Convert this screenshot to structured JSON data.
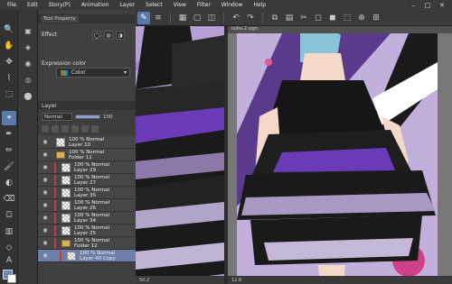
{
  "menu": [
    "File",
    "Edit",
    "Story(P)",
    "Animation",
    "Layer",
    "Select",
    "View",
    "Filter",
    "Window",
    "Help"
  ],
  "window_controls": {
    "minimize": "–",
    "maximize": "□",
    "close": "✕"
  },
  "panel": {
    "tabs": [
      "Tool Property"
    ],
    "effect_label": "Effect",
    "expression_color_label": "Expression color",
    "expression_color_value": "Color",
    "layer_tab": "Layer",
    "blend_mode": "Normal",
    "opacity": "100",
    "opacity_fraction": 1.0
  },
  "layers": [
    {
      "text": "100 % Normal\nLayer 10",
      "type": "layer",
      "indent": 0,
      "selected": false
    },
    {
      "text": "100 % Normal\nFolder 11",
      "type": "folder",
      "indent": 0,
      "selected": false
    },
    {
      "text": "100 % Normal\nLayer 29",
      "type": "layer",
      "indent": 1,
      "selected": false
    },
    {
      "text": "100 % Normal\nLayer 27",
      "type": "layer",
      "indent": 1,
      "selected": false
    },
    {
      "text": "100 % Normal\nLayer 35",
      "type": "layer",
      "indent": 1,
      "selected": false
    },
    {
      "text": "100 % Normal\nLayer 26",
      "type": "layer",
      "indent": 1,
      "selected": false
    },
    {
      "text": "100 % Normal\nLayer 34",
      "type": "layer",
      "indent": 1,
      "selected": false
    },
    {
      "text": "100 % Normal\nLayer 25",
      "type": "layer",
      "indent": 1,
      "selected": false
    },
    {
      "text": "100 % Normal\nFolder 12",
      "type": "folder",
      "indent": 1,
      "selected": false
    },
    {
      "text": "100 % Normal\nLayer 40 Copy",
      "type": "layer",
      "indent": 2,
      "selected": true
    }
  ],
  "canvas": {
    "left_zoom": "50.2",
    "right_zoom": "12.6",
    "right_tab": "lolita 2 sign"
  },
  "colors": {
    "accent": "#5a78a8",
    "main_color": "#6c89b8",
    "sub_color": "#ffffff",
    "background_purple": "#b4a0d4",
    "dress_purple": "#6a3ab8",
    "dress_black": "#1a1a1a"
  },
  "tools": [
    "magnifier-icon",
    "hand-icon",
    "move-icon",
    "lasso-icon",
    "select-icon",
    "eyedropper-icon",
    "pen-icon",
    "pencil-icon",
    "brush-icon",
    "airbrush-icon",
    "eraser-icon",
    "fill-icon",
    "gradient-icon",
    "figure-icon",
    "text-icon",
    "ruler-icon"
  ]
}
